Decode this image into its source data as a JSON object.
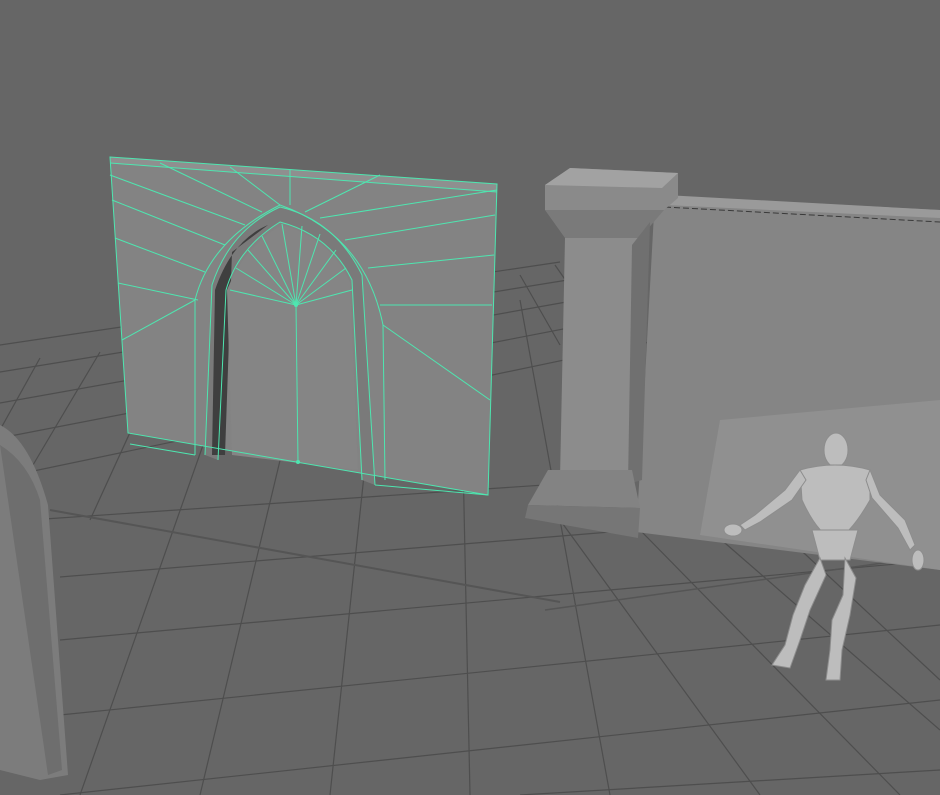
{
  "viewport": {
    "label": "3D viewport",
    "background_color": "#666666",
    "grid_color": "#4d4d4d",
    "wire_color": "#4ee6b0"
  },
  "scene": {
    "objects": [
      {
        "name": "arch-door-wall",
        "selected": true,
        "display": "wireframe-on-shaded"
      },
      {
        "name": "stone-pillar",
        "selected": false
      },
      {
        "name": "long-wall",
        "selected": false
      },
      {
        "name": "arched-wall-partial",
        "selected": false
      },
      {
        "name": "humanoid-mannequin",
        "selected": false,
        "pose": "a-pose"
      }
    ]
  }
}
